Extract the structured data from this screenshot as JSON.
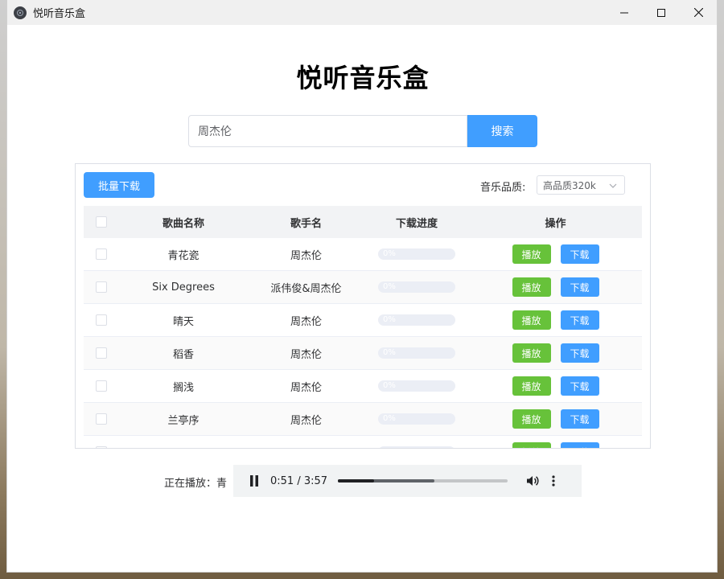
{
  "window": {
    "title": "悦听音乐盒"
  },
  "page": {
    "title": "悦听音乐盒"
  },
  "search": {
    "value": "周杰伦",
    "button": "搜索"
  },
  "toolbar": {
    "batch_download": "批量下载",
    "quality_label": "音乐品质:",
    "quality_selected": "高品质320k"
  },
  "table": {
    "headers": {
      "name": "歌曲名称",
      "singer": "歌手名",
      "progress": "下载进度",
      "ops": "操作"
    },
    "rows": [
      {
        "name": "青花瓷",
        "singer": "周杰伦",
        "progress": 0,
        "progress_text": "0%"
      },
      {
        "name": "Six Degrees",
        "singer": "派伟俊&周杰伦",
        "progress": 0,
        "progress_text": "0%"
      },
      {
        "name": "晴天",
        "singer": "周杰伦",
        "progress": 0,
        "progress_text": "0%"
      },
      {
        "name": "稻香",
        "singer": "周杰伦",
        "progress": 0,
        "progress_text": "0%"
      },
      {
        "name": "搁浅",
        "singer": "周杰伦",
        "progress": 0,
        "progress_text": "0%"
      },
      {
        "name": "兰亭序",
        "singer": "周杰伦",
        "progress": 0,
        "progress_text": "0%"
      },
      {
        "name": "",
        "singer": "",
        "progress": 0,
        "progress_text": ""
      }
    ],
    "play_label": "播放",
    "download_label": "下载"
  },
  "player": {
    "now_playing_label": "正在播放：青",
    "time": "0:51 / 3:57",
    "played_fraction": 0.215,
    "buffered_fraction": 0.57
  },
  "colors": {
    "primary": "#409eff",
    "success": "#67c23a"
  },
  "icons": [
    "app-icon",
    "minimize-icon",
    "maximize-icon",
    "close-icon",
    "chevron-down-icon",
    "pause-icon",
    "volume-icon",
    "more-vert-icon"
  ]
}
